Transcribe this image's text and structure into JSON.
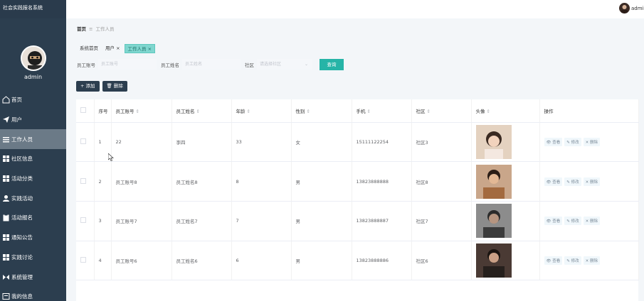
{
  "app": {
    "title": "社会实践报名系统",
    "user_name": "admin",
    "top_user_name": "admin"
  },
  "sidebar": {
    "items": [
      {
        "label": "首页",
        "icon": "home-icon"
      },
      {
        "label": "用户",
        "icon": "send-icon"
      },
      {
        "label": "工作人员",
        "icon": "menu-lines-icon"
      },
      {
        "label": "社区信息",
        "icon": "grid-icon"
      },
      {
        "label": "活动分类",
        "icon": "grid-icon"
      },
      {
        "label": "实践活动",
        "icon": "user-icon"
      },
      {
        "label": "活动报名",
        "icon": "clipboard-icon"
      },
      {
        "label": "通知公告",
        "icon": "grid-icon"
      },
      {
        "label": "实践讨论",
        "icon": "grid-icon"
      },
      {
        "label": "系统管理",
        "icon": "swap-icon"
      },
      {
        "label": "我的信息",
        "icon": "document-icon"
      }
    ],
    "active_index": 2
  },
  "breadcrumb": {
    "home": "首页",
    "separator": "≡",
    "current": "工作人员"
  },
  "tags": [
    {
      "label": "系统首页",
      "closable": false,
      "active": false
    },
    {
      "label": "用户",
      "closable": true,
      "active": false
    },
    {
      "label": "工作人员",
      "closable": true,
      "active": true
    }
  ],
  "search": {
    "field1_label": "员工账号",
    "field1_placeholder": "员工账号",
    "field2_label": "员工姓名",
    "field2_placeholder": "员工姓名",
    "field3_label": "社区",
    "field3_placeholder": "请选择社区",
    "button": "查询"
  },
  "actions": {
    "add": "+ 添加",
    "delete": "🗑 删除"
  },
  "table": {
    "headers": [
      "",
      "序号",
      "员工账号",
      "员工姓名",
      "年龄",
      "性别",
      "手机",
      "社区",
      "头像",
      "操作"
    ],
    "sortable": [
      false,
      false,
      true,
      true,
      true,
      true,
      true,
      true,
      true,
      false
    ],
    "rows": [
      {
        "no": "1",
        "account": "22",
        "name": "李四",
        "age": "33",
        "gender": "女",
        "phone": "15111122254",
        "community": "社区3"
      },
      {
        "no": "2",
        "account": "员工账号8",
        "name": "员工姓名8",
        "age": "8",
        "gender": "男",
        "phone": "13823888888",
        "community": "社区8"
      },
      {
        "no": "3",
        "account": "员工账号7",
        "name": "员工姓名7",
        "age": "7",
        "gender": "男",
        "phone": "13823888887",
        "community": "社区7"
      },
      {
        "no": "4",
        "account": "员工账号6",
        "name": "员工姓名6",
        "age": "6",
        "gender": "男",
        "phone": "13823888886",
        "community": "社区6"
      }
    ],
    "row_actions": {
      "view": "查看",
      "edit": "修改",
      "delete": "删除"
    }
  },
  "colors": {
    "sidebar_bg": "#2c3e4f",
    "accent": "#26b4a7",
    "tag_active": "#7fd6cf"
  }
}
